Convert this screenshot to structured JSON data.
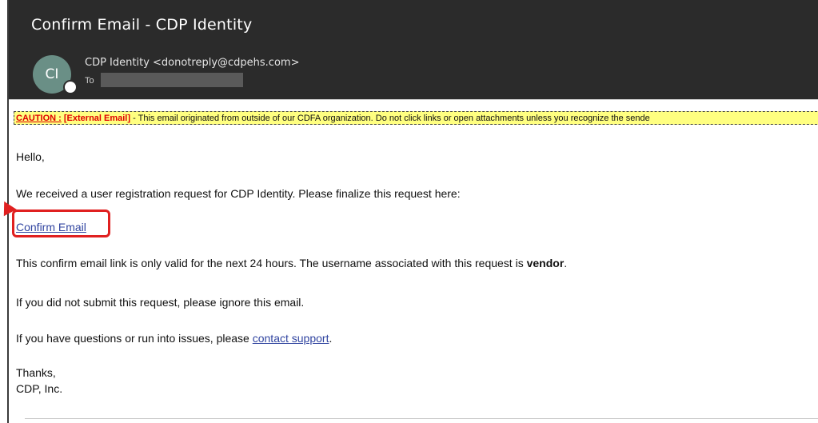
{
  "email": {
    "subject": "Confirm Email - CDP Identity",
    "avatar_initials": "CI",
    "sender": "CDP Identity <donotreply@cdpehs.com>",
    "to_label": "To"
  },
  "caution": {
    "label": "CAUTION :",
    "tag": "[External Email]",
    "text": " - This email originated from outside of our CDFA organization. Do not click links or open attachments unless you recognize the sende"
  },
  "message": {
    "greeting": "Hello,",
    "intro": "We received a user registration request for CDP Identity. Please finalize this request here:",
    "confirm_link": "Confirm Email",
    "validity_prefix": "This confirm email link is only valid for the next 24 hours. The username associated with this request is ",
    "username": "vendor",
    "validity_suffix": ".",
    "ignore": "If you did not submit this request, please ignore this email.",
    "support_prefix": "If you have questions or run into issues, please ",
    "support_link": "contact support",
    "support_suffix": ".",
    "closing": "Thanks,",
    "signature": "CDP, Inc."
  },
  "colors": {
    "header_bg": "#2b2b2b",
    "avatar_bg": "#6a8f86",
    "caution_bg": "#ffff80",
    "caution_red": "#e00000",
    "link": "#3044a0",
    "highlight": "#e02020"
  }
}
